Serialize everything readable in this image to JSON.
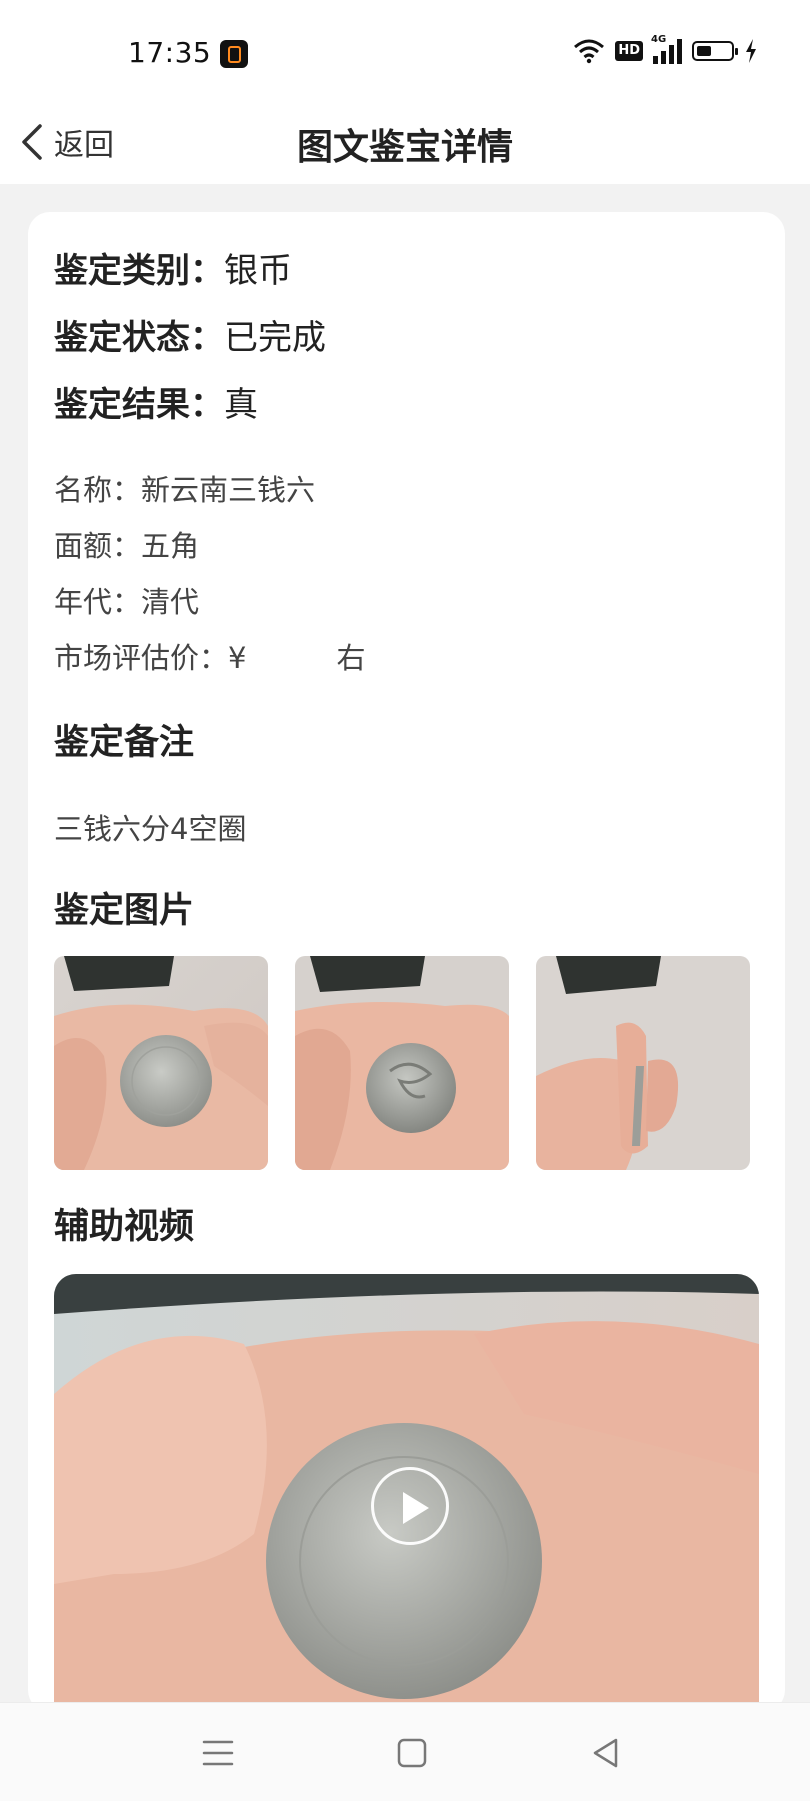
{
  "status_bar": {
    "time": "17:35",
    "icons": [
      "app-badge-icon",
      "wifi-icon",
      "hd-icon",
      "signal-4g-icon",
      "battery-icon",
      "charging-icon"
    ],
    "hd_label": "HD",
    "network_label": "4G"
  },
  "nav": {
    "back_label": "返回",
    "title": "图文鉴宝详情"
  },
  "appraisal": {
    "category_key": "鉴定类别：",
    "category_value": "银币",
    "status_key": "鉴定状态：",
    "status_value": "已完成",
    "result_key": "鉴定结果：",
    "result_value": "真"
  },
  "details": {
    "name_key": "名称：",
    "name_value": "新云南三钱六",
    "denomination_key": "面额：",
    "denomination_value": "五角",
    "era_key": "年代：",
    "era_value": "清代",
    "price_key": "市场评估价：",
    "price_symbol": "¥",
    "price_suffix": "右"
  },
  "remark": {
    "title": "鉴定备注",
    "text": "三钱六分4空圈"
  },
  "images": {
    "title": "鉴定图片",
    "count": 3
  },
  "video": {
    "title": "辅助视频"
  },
  "colors": {
    "page_bg": "#f2f2f2",
    "card_bg": "#ffffff",
    "text_primary": "#222222",
    "text_secondary": "#444444"
  }
}
